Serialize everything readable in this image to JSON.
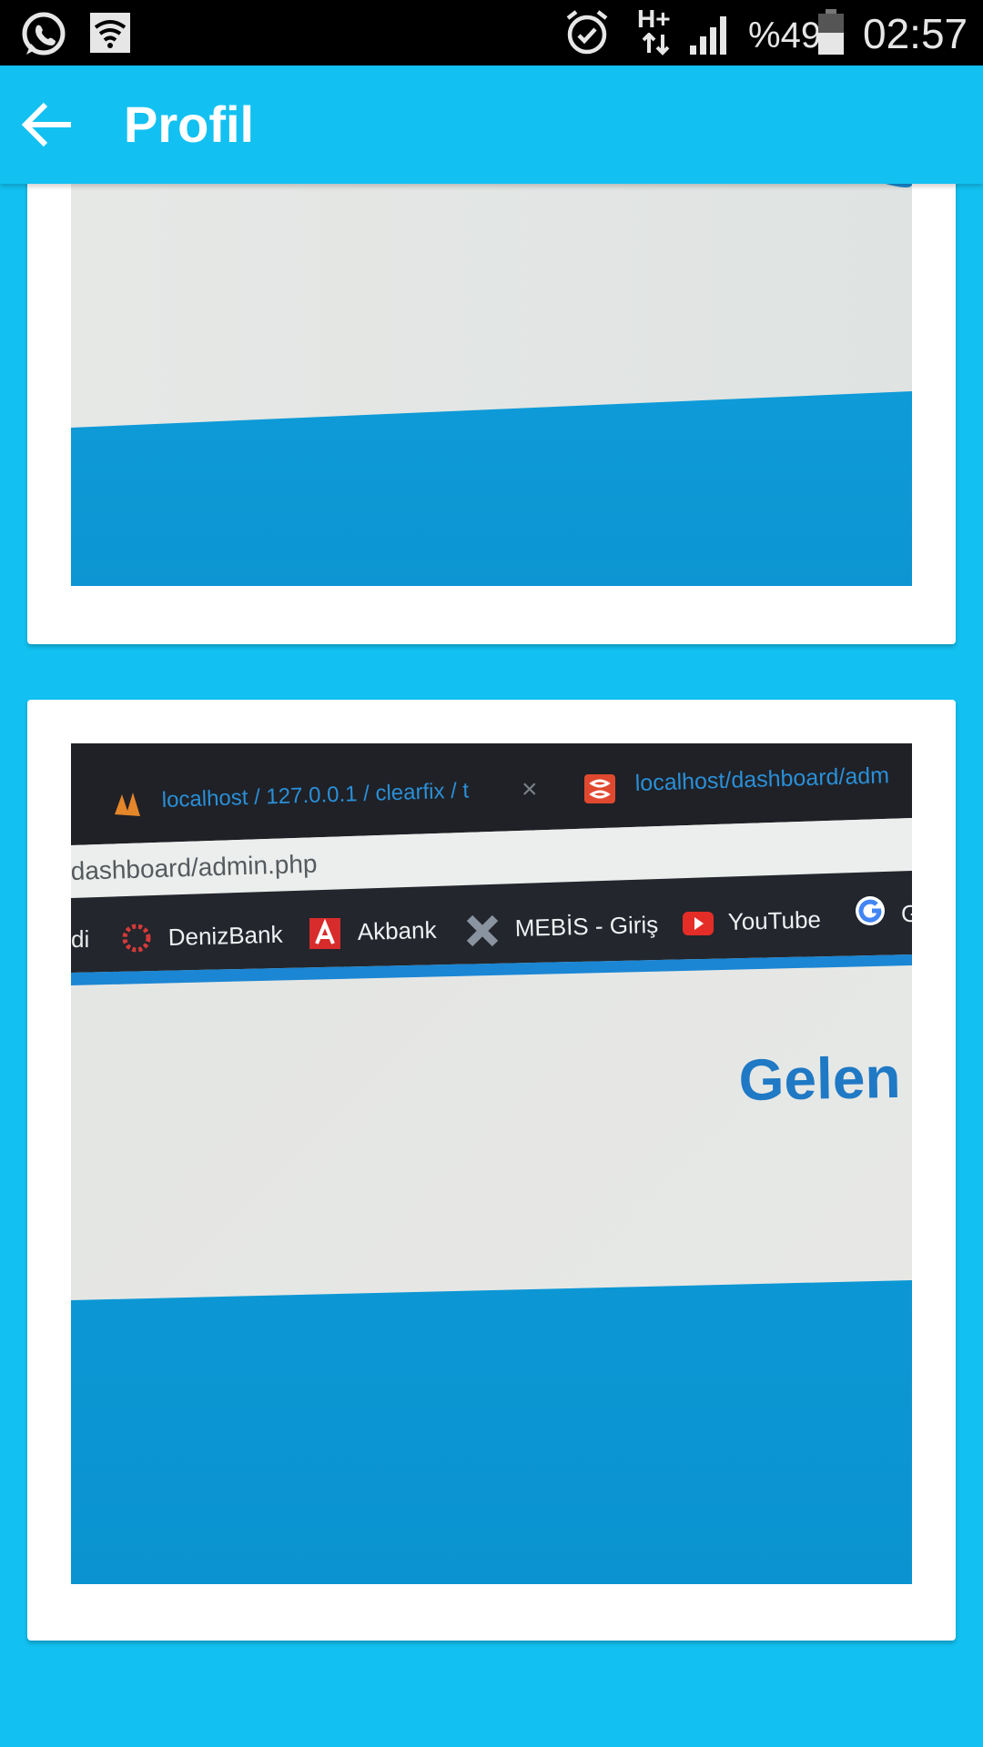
{
  "status_bar": {
    "icons": [
      "whatsapp-icon",
      "wifi-image-icon",
      "alarm-icon",
      "hplus-data-icon",
      "signal-icon",
      "battery-icon"
    ],
    "network": "H+",
    "battery": "%49",
    "time": "02:57"
  },
  "app_bar": {
    "title": "Profil",
    "back_icon": "arrow-left-icon"
  },
  "colors": {
    "primary": "#12c1f1",
    "card": "#ffffff",
    "photo_blue": "#0a98d6",
    "photo_dark": "#1f2126",
    "photo_link": "#2a8fd8",
    "photo_heading": "#1f79c4"
  },
  "cards": [
    {
      "type": "photo-of-screen"
    },
    {
      "type": "photo-of-screen",
      "photo_text": {
        "tab_1": "localhost / 127.0.0.1 / clearfix / t",
        "tab_1_close": "×",
        "tab_2": "localhost/dashboard/adm",
        "url": "dashboard/admin.php",
        "bookmark_fragment": "di",
        "bookmarks": [
          "DenizBank",
          "Akbank",
          "MEBİS - Giriş",
          "YouTube",
          "G"
        ],
        "heading": "Gelen"
      }
    }
  ]
}
